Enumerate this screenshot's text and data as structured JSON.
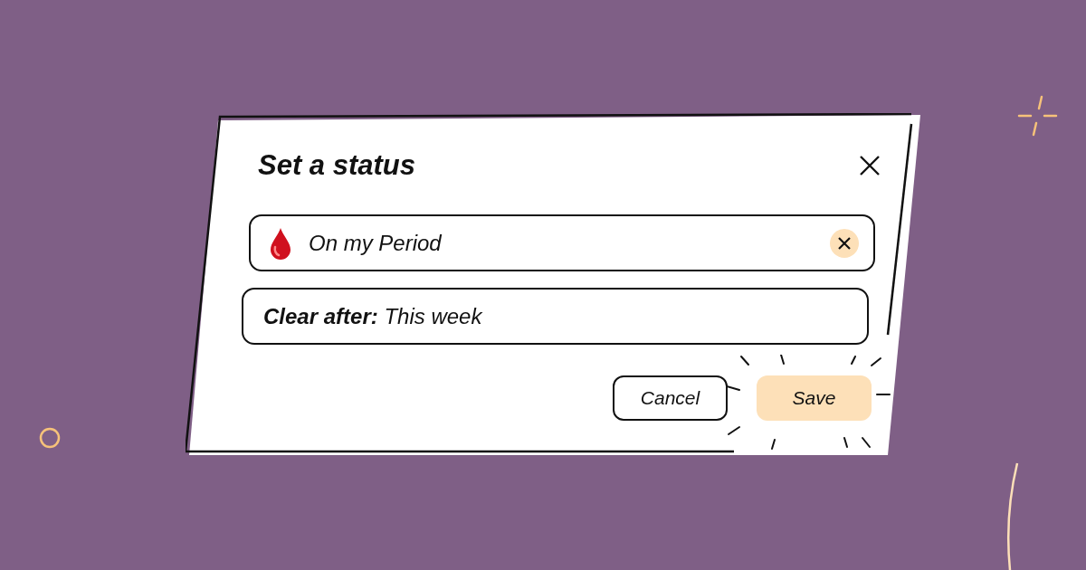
{
  "dialog": {
    "title": "Set a status"
  },
  "status_field": {
    "value": "On my Period"
  },
  "clear_after": {
    "text": "**Clear after:** This week"
  },
  "buttons": [
    {
      "label": "Cancel",
      "kind": "secondary"
    },
    {
      "label": "Save",
      "kind": "primary"
    }
  ]
}
